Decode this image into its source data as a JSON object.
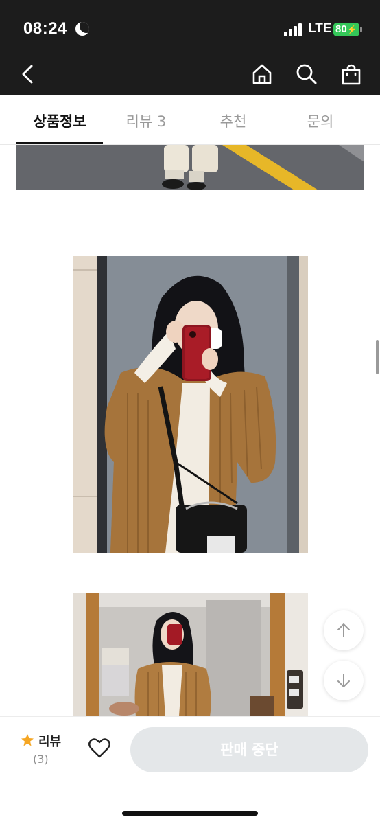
{
  "status_bar": {
    "time": "08:24",
    "network": "LTE",
    "battery": "80",
    "icons": [
      "moon-icon",
      "signal-icon",
      "battery-icon"
    ]
  },
  "nav": {
    "icons": [
      "back-icon",
      "home-icon",
      "search-icon",
      "shopping-bag-icon"
    ]
  },
  "tabs": [
    {
      "label": "상품정보",
      "active": true
    },
    {
      "label": "리뷰 3",
      "active": false
    },
    {
      "label": "추천",
      "active": false
    },
    {
      "label": "문의",
      "active": false
    }
  ],
  "scroll_buttons": {
    "icons": [
      "arrow-up-icon",
      "arrow-down-icon"
    ]
  },
  "bottom_bar": {
    "review_label": "리뷰",
    "review_count": "(3)",
    "sell_button_label": "판매 중단",
    "icons": [
      "star-icon",
      "heart-icon"
    ]
  },
  "colors": {
    "top_bar": "#1c1c1c",
    "battery": "#34c759",
    "star": "#f5a623",
    "disabled_button": "#e4e7e9"
  }
}
